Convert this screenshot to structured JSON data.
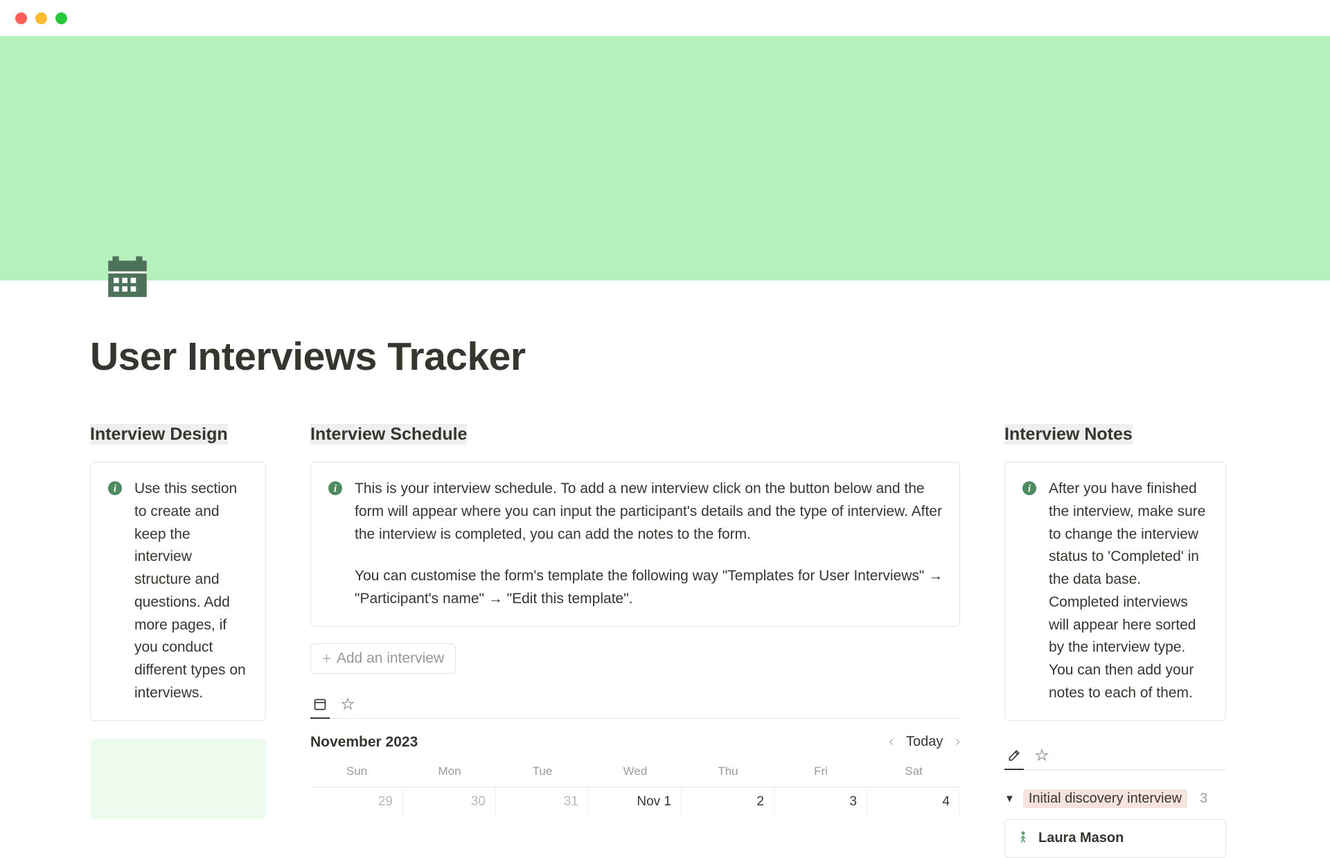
{
  "title": "User Interviews Tracker",
  "sections": {
    "design": {
      "heading": "Interview Design",
      "callout": "Use this section to create and keep the interview structure and questions. Add more pages, if you conduct different types on interviews."
    },
    "schedule": {
      "heading": "Interview Schedule",
      "callout_p1": "This is your interview schedule. To add a new interview click on the button below and the form will appear where you can input the participant's details and the type of interview. After the interview is completed, you can add the notes to the form.",
      "callout_p2": "You can customise the form's template the following way \"Templates for User Interviews\" → \"Participant's name\" → \"Edit this template\".",
      "add_button": "Add an interview"
    },
    "notes": {
      "heading": "Interview Notes",
      "callout": "After you have finished the interview, make sure to change the interview status to 'Completed' in the data base. Completed interviews will appear here sorted by the interview type. You can then add your notes to each of them."
    }
  },
  "calendar": {
    "month": "November 2023",
    "today_label": "Today",
    "weekdays": [
      "Sun",
      "Mon",
      "Tue",
      "Wed",
      "Thu",
      "Fri",
      "Sat"
    ],
    "row1": [
      "29",
      "30",
      "31",
      "Nov 1",
      "2",
      "3",
      "4"
    ]
  },
  "notes_group": {
    "tag": "Initial discovery interview",
    "count": "3",
    "person": "Laura Mason"
  }
}
